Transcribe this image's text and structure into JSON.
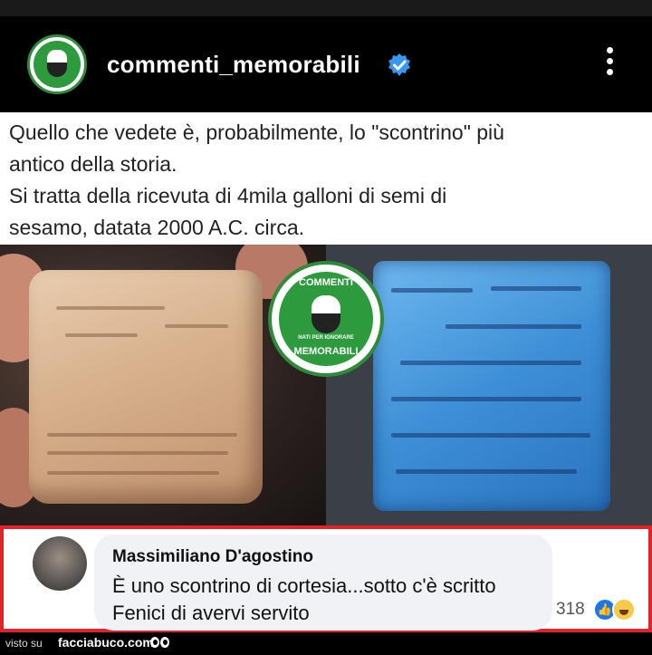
{
  "post": {
    "account": {
      "username": "commenti_memorabili",
      "verified": true,
      "logo_text": [
        "COMMENTI",
        "MEMORABILI"
      ]
    },
    "menu_icon": "more-vertical-icon",
    "caption_lines": [
      "Quello che vedete è, probabilmente, lo \"scontrino\" più",
      "antico della storia.",
      "Si tratta della ricevuta di 4mila galloni di semi di",
      "sesamo, datata 2000 A.C. circa."
    ],
    "watermark": {
      "top": "COMMENTI",
      "bottom": "MEMORABILI",
      "tagline": "NATI PER IGNORARE"
    }
  },
  "comment": {
    "author": "Massimiliano D'agostino",
    "lines": [
      "È uno scontrino di cortesia...sotto c'è scritto",
      "Fenici di avervi servito"
    ],
    "reaction_count": "318",
    "reactions": [
      "like-icon",
      "haha-icon"
    ]
  },
  "footer": {
    "prefix": "visto su",
    "site": "facciabuco.com"
  },
  "colors": {
    "brand_green": "#2e8b3a",
    "highlight_red": "#e0242a",
    "verified_blue": "#3897f0",
    "facebook_blue": "#1877f2"
  }
}
